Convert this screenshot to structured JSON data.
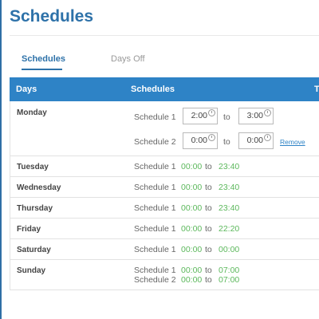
{
  "page": {
    "title": "Schedules"
  },
  "tabs": [
    {
      "label": "Schedules",
      "active": true
    },
    {
      "label": "Days Off",
      "active": false
    }
  ],
  "table": {
    "headers": [
      "Days",
      "Schedules",
      "T"
    ],
    "remove_label": "Remove",
    "to_word": "to",
    "monday": {
      "day": "Monday",
      "schedules": [
        {
          "label": "Schedule 1",
          "from": "2:00",
          "to": "3:00"
        },
        {
          "label": "Schedule 2",
          "from": "0:00",
          "to": "0:00"
        }
      ]
    },
    "rows": [
      {
        "day": "Tuesday",
        "schedules": [
          {
            "label": "Schedule 1",
            "from": "00:00",
            "to": "23:40"
          }
        ]
      },
      {
        "day": "Wednesday",
        "schedules": [
          {
            "label": "Schedule 1",
            "from": "00:00",
            "to": "23:40"
          }
        ]
      },
      {
        "day": "Thursday",
        "schedules": [
          {
            "label": "Schedule 1",
            "from": "00:00",
            "to": "23:40"
          }
        ]
      },
      {
        "day": "Friday",
        "schedules": [
          {
            "label": "Schedule 1",
            "from": "00:00",
            "to": "22:20"
          }
        ]
      },
      {
        "day": "Saturday",
        "schedules": [
          {
            "label": "Schedule 1",
            "from": "00:00",
            "to": "00:00"
          }
        ]
      },
      {
        "day": "Sunday",
        "schedules": [
          {
            "label": "Schedule 1",
            "from": "00:00",
            "to": "07:00"
          },
          {
            "label": "Schedule 2",
            "from": "00:00",
            "to": "07:00"
          }
        ]
      }
    ]
  },
  "colors": {
    "accent": "#2e72a9",
    "header_bg": "#2e83c6",
    "time_green": "#5cb85c"
  }
}
